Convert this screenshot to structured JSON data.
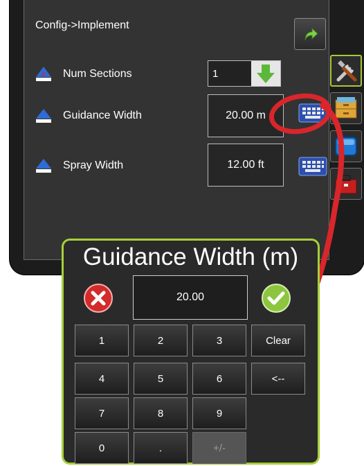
{
  "header": {
    "breadcrumb": "Config->Implement"
  },
  "rows": {
    "num_sections": {
      "label": "Num Sections",
      "value": "1"
    },
    "guidance_width": {
      "label": "Guidance Width",
      "value": "20.00 m"
    },
    "spray_width": {
      "label": "Spray Width",
      "value": "12.00 ft"
    }
  },
  "keypad": {
    "title": "Guidance Width (m)",
    "value": "20.00",
    "keys": [
      "1",
      "2",
      "3",
      "Clear",
      "4",
      "5",
      "6",
      "<--",
      "7",
      "8",
      "9",
      "0",
      ".",
      "+/-"
    ],
    "disabled_keys": [
      "+/-"
    ]
  },
  "colors": {
    "accent_green": "#a7cf3a",
    "callout_red": "#d8262b",
    "cancel_red": "#d32a2a",
    "accept_green": "#8cc63f"
  },
  "icons": [
    "back-arrow-icon",
    "triangle-icon",
    "down-arrow-icon",
    "keyboard-icon",
    "tools-icon",
    "cabinet-icon",
    "display-icon",
    "toolbox-icon",
    "cancel-x-icon",
    "checkmark-icon"
  ]
}
